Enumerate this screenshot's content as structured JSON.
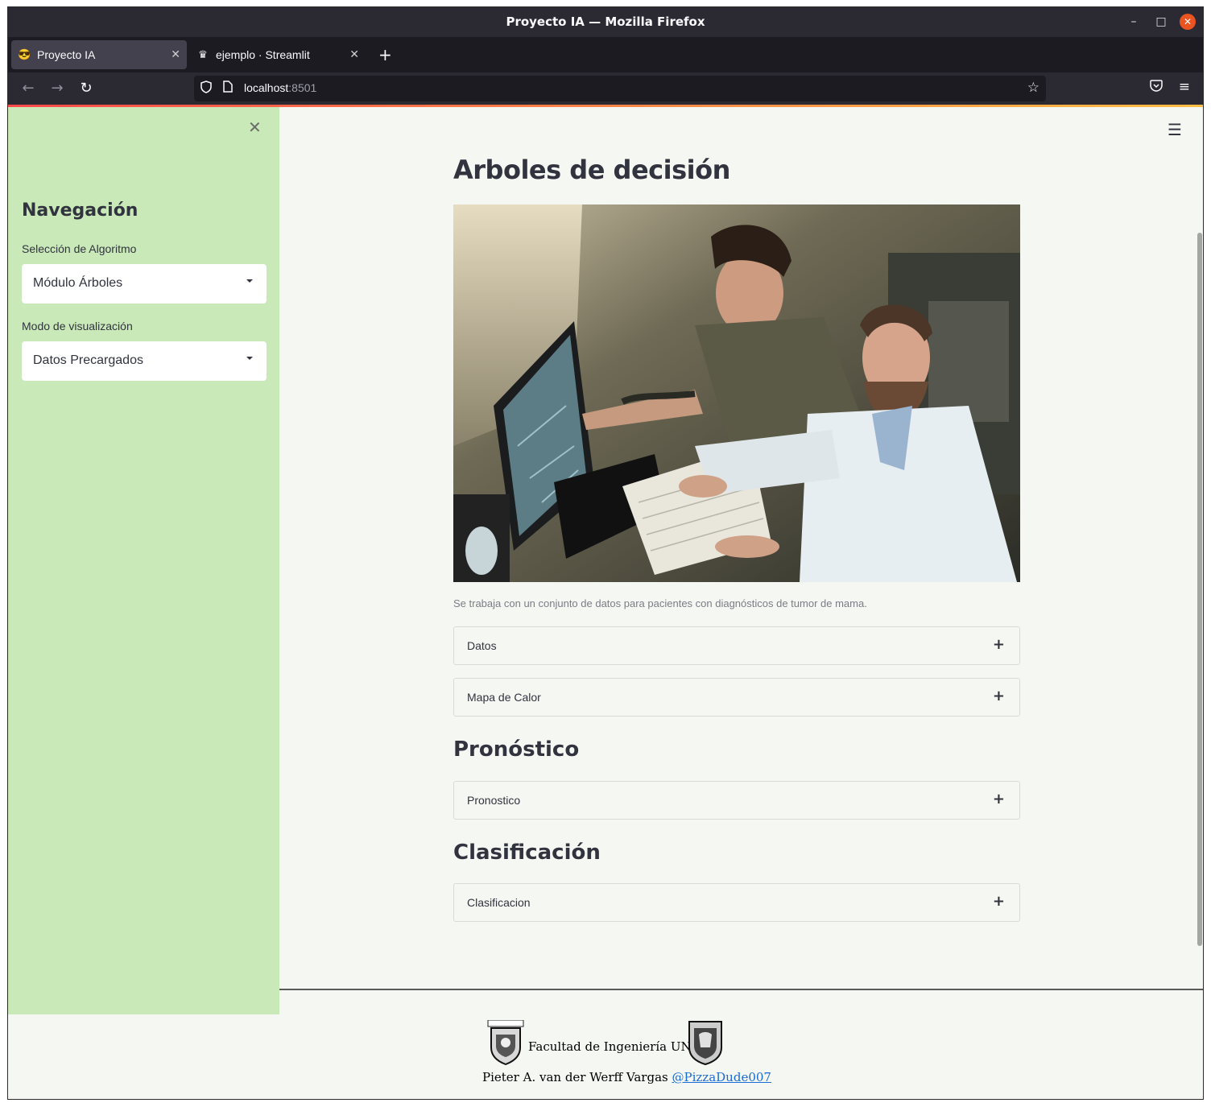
{
  "window": {
    "title": "Proyecto IA — Mozilla Firefox",
    "controls": {
      "minimize": "–",
      "maximize": "□",
      "close": "✕"
    }
  },
  "tabs": [
    {
      "label": "Proyecto IA",
      "favicon": "😎",
      "active": true
    },
    {
      "label": "ejemplo · Streamlit",
      "favicon": "♛",
      "active": false
    }
  ],
  "navbar": {
    "url_host": "localhost",
    "url_port": ":8501"
  },
  "sidebar": {
    "heading": "Navegación",
    "algorithm_label": "Selección de Algoritmo",
    "algorithm_value": "Módulo Árboles",
    "mode_label": "Modo de visualización",
    "mode_value": "Datos Precargados"
  },
  "main": {
    "title": "Arboles de decisión",
    "caption": "Se trabaja con un conjunto de datos para pacientes con diagnósticos de tumor de mama.",
    "expanders_top": [
      "Datos",
      "Mapa de Calor"
    ],
    "section_pronostico": "Pronóstico",
    "expander_pronostico": "Pronostico",
    "section_clasificacion": "Clasificación",
    "expander_clasificacion": "Clasificacion"
  },
  "footer": {
    "organization": "Facultad de Ingeniería UNAM",
    "author": "Pieter A. van der Werff Vargas",
    "handle": "@PizzaDude007"
  },
  "colors": {
    "sidebar_bg": "#c9e9b8",
    "main_bg": "#f5f7f3",
    "text": "#31333f",
    "link": "#1a6bd6",
    "accent_close": "#e95420"
  }
}
